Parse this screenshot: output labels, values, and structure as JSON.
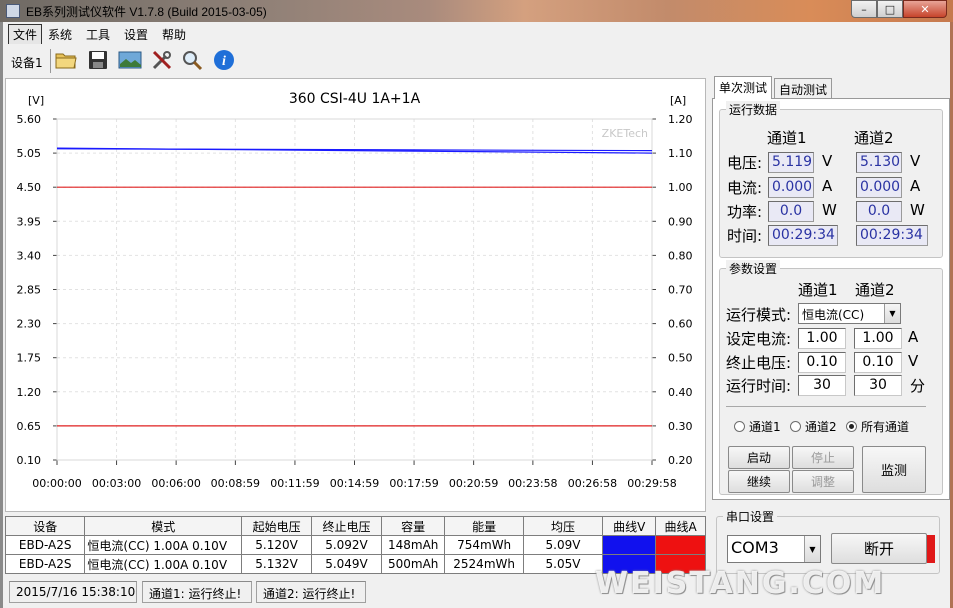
{
  "window": {
    "title": "EB系列测试仪软件 V1.7.8 (Build 2015-03-05)",
    "minimize": "–",
    "maximize": "□",
    "close": "✕"
  },
  "menu": [
    "文件",
    "系统",
    "工具",
    "设置",
    "帮助"
  ],
  "toolbar": {
    "device_tab": "设备1",
    "icons": [
      "open-folder-icon",
      "save-icon",
      "image-icon",
      "tools-icon",
      "magnifier-icon",
      "info-icon"
    ]
  },
  "chart_data": {
    "type": "line",
    "title": "360 CSI-4U 1A+1A",
    "watermark": "ZKETech",
    "y_left_label": "[V]",
    "y_right_label": "[A]",
    "y_left_ticks": [
      "5.60",
      "5.05",
      "4.50",
      "3.95",
      "3.40",
      "2.85",
      "2.30",
      "1.75",
      "1.20",
      "0.65",
      "0.10"
    ],
    "y_right_ticks": [
      "1.20",
      "1.10",
      "1.00",
      "0.90",
      "0.80",
      "0.70",
      "0.60",
      "0.50",
      "0.40",
      "0.30",
      "0.20"
    ],
    "x_ticks": [
      "00:00:00",
      "00:03:00",
      "00:06:00",
      "00:08:59",
      "00:11:59",
      "00:14:59",
      "00:17:59",
      "00:20:59",
      "00:23:58",
      "00:26:58",
      "00:29:58"
    ],
    "ylim_left": [
      0.1,
      5.6
    ],
    "ylim_right": [
      0.2,
      1.2
    ],
    "grid": true,
    "series": [
      {
        "axis": "left",
        "color": "#1a1aff",
        "x": [
          "00:00:00",
          "00:29:58"
        ],
        "values": [
          5.12,
          5.09
        ]
      },
      {
        "axis": "left",
        "color": "#1a1aff",
        "x": [
          "00:00:00",
          "00:29:58"
        ],
        "values": [
          5.13,
          5.05
        ]
      },
      {
        "axis": "right",
        "color": "#e02020",
        "x": [
          "00:00:00",
          "00:29:58"
        ],
        "values": [
          1.0,
          1.0
        ]
      },
      {
        "axis": "right",
        "color": "#e02020",
        "x": [
          "00:00:00",
          "00:29:58"
        ],
        "values": [
          0.3,
          0.3
        ]
      }
    ]
  },
  "table": {
    "headers": [
      "设备",
      "模式",
      "起始电压",
      "终止电压",
      "容量",
      "能量",
      "均压",
      "曲线V",
      "曲线A"
    ],
    "rows": [
      {
        "device": "EBD-A2S",
        "mode": "恒电流(CC)  1.00A  0.10V",
        "start_v": "5.120V",
        "end_v": "5.092V",
        "capacity": "148mAh",
        "energy": "754mWh",
        "avg_v": "5.09V",
        "curve_v_color": "#1111ee",
        "curve_a_color": "#ee1111"
      },
      {
        "device": "EBD-A2S",
        "mode": "恒电流(CC)  1.00A  0.10V",
        "start_v": "5.132V",
        "end_v": "5.049V",
        "capacity": "500mAh",
        "energy": "2524mWh",
        "avg_v": "5.05V",
        "curve_v_color": "#1111ee",
        "curve_a_color": "#ee1111"
      }
    ]
  },
  "status": {
    "timestamp": "2015/7/16 15:38:10",
    "ch1": "通道1: 运行终止!",
    "ch2": "通道2: 运行终止!"
  },
  "right_tabs": [
    "单次测试",
    "自动测试"
  ],
  "run_data": {
    "group_label": "运行数据",
    "ch1_header": "通道1",
    "ch2_header": "通道2",
    "voltage_label": "电压:",
    "current_label": "电流:",
    "power_label": "功率:",
    "time_label": "时间:",
    "unit_v": "V",
    "unit_a": "A",
    "unit_w": "W",
    "ch1": {
      "voltage": "5.119",
      "current": "0.000",
      "power": "0.0",
      "time": "00:29:34"
    },
    "ch2": {
      "voltage": "5.130",
      "current": "0.000",
      "power": "0.0",
      "time": "00:29:34"
    }
  },
  "params": {
    "group_label": "参数设置",
    "ch1_header": "通道1",
    "ch2_header": "通道2",
    "mode_label": "运行模式:",
    "mode_value": "恒电流(CC)",
    "set_current_label": "设定电流:",
    "end_voltage_label": "终止电压:",
    "run_time_label": "运行时间:",
    "unit_a": "A",
    "unit_v": "V",
    "unit_min": "分",
    "ch1": {
      "current": "1.00",
      "end_voltage": "0.10",
      "run_time": "30"
    },
    "ch2": {
      "current": "1.00",
      "end_voltage": "0.10",
      "run_time": "30"
    },
    "radios": [
      "通道1",
      "通道2",
      "所有通道"
    ],
    "selected_radio": "所有通道",
    "buttons": {
      "start": "启动",
      "stop": "停止",
      "continue": "继续",
      "adjust": "调整",
      "monitor": "监测"
    }
  },
  "serial": {
    "group_label": "串口设置",
    "port": "COM3",
    "disconnect": "断开",
    "indicator_color": "#e01818"
  },
  "overlay_watermark": "WEISTANG.COM"
}
